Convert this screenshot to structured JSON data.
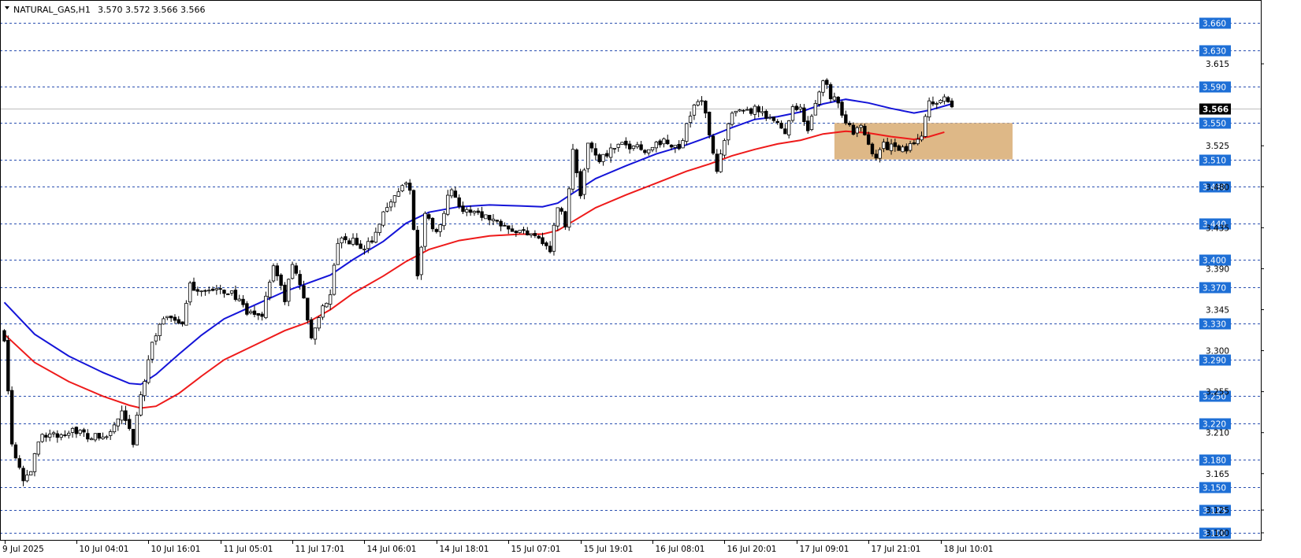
{
  "header": {
    "symbol_line": "NATURAL_GAS,H1",
    "ohlc": "3.570 3.572 3.566 3.566"
  },
  "colors": {
    "background": "#ffffff",
    "grid_level": "#2a4fb0",
    "level_badge": "#1e6fd6",
    "ema_fast": "#1414d8",
    "ema_slow": "#ee1a1a",
    "zone": "#deb887",
    "candle_up": "#ffffff",
    "candle_down": "#000000"
  },
  "chart_data": {
    "type": "candlestick",
    "symbol": "NATURAL_GAS",
    "timeframe": "H1",
    "last_price": "3.566",
    "ylim": [
      3.1,
      3.66
    ],
    "y_ticks": [
      "3.615",
      "3.525",
      "3.480",
      "3.435",
      "3.390",
      "3.345",
      "3.300",
      "3.255",
      "3.210",
      "3.165",
      "3.125",
      "3.100"
    ],
    "level_lines": [
      "3.660",
      "3.630",
      "3.590",
      "3.550",
      "3.510",
      "3.480",
      "3.440",
      "3.400",
      "3.370",
      "3.330",
      "3.290",
      "3.250",
      "3.220",
      "3.180",
      "3.150",
      "3.125",
      "3.100"
    ],
    "x_ticks": [
      {
        "label": "9 Jul 2025",
        "bar": 0
      },
      {
        "label": "10 Jul 04:01",
        "bar": 19
      },
      {
        "label": "10 Jul 16:01",
        "bar": 38
      },
      {
        "label": "11 Jul 05:01",
        "bar": 57
      },
      {
        "label": "11 Jul 17:01",
        "bar": 76
      },
      {
        "label": "14 Jul 06:01",
        "bar": 95
      },
      {
        "label": "14 Jul 18:01",
        "bar": 114
      },
      {
        "label": "15 Jul 07:01",
        "bar": 133
      },
      {
        "label": "15 Jul 19:01",
        "bar": 152
      },
      {
        "label": "16 Jul 08:01",
        "bar": 171
      },
      {
        "label": "16 Jul 20:01",
        "bar": 190
      },
      {
        "label": "17 Jul 09:01",
        "bar": 209
      },
      {
        "label": "17 Jul 21:01",
        "bar": 228
      },
      {
        "label": "18 Jul 10:01",
        "bar": 247
      }
    ],
    "anchors": [
      {
        "bar": 0,
        "price": 3.315
      },
      {
        "bar": 2,
        "price": 3.2
      },
      {
        "bar": 5,
        "price": 3.16
      },
      {
        "bar": 7,
        "price": 3.17
      },
      {
        "bar": 10,
        "price": 3.21
      },
      {
        "bar": 14,
        "price": 3.205
      },
      {
        "bar": 18,
        "price": 3.215
      },
      {
        "bar": 22,
        "price": 3.205
      },
      {
        "bar": 27,
        "price": 3.205
      },
      {
        "bar": 31,
        "price": 3.23
      },
      {
        "bar": 34,
        "price": 3.2
      },
      {
        "bar": 36,
        "price": 3.25
      },
      {
        "bar": 39,
        "price": 3.31
      },
      {
        "bar": 43,
        "price": 3.34
      },
      {
        "bar": 47,
        "price": 3.33
      },
      {
        "bar": 49,
        "price": 3.37
      },
      {
        "bar": 55,
        "price": 3.365
      },
      {
        "bar": 60,
        "price": 3.365
      },
      {
        "bar": 64,
        "price": 3.34
      },
      {
        "bar": 68,
        "price": 3.34
      },
      {
        "bar": 71,
        "price": 3.395
      },
      {
        "bar": 74,
        "price": 3.355
      },
      {
        "bar": 76,
        "price": 3.395
      },
      {
        "bar": 79,
        "price": 3.36
      },
      {
        "bar": 81,
        "price": 3.31
      },
      {
        "bar": 84,
        "price": 3.35
      },
      {
        "bar": 86,
        "price": 3.36
      },
      {
        "bar": 88,
        "price": 3.42
      },
      {
        "bar": 92,
        "price": 3.42
      },
      {
        "bar": 95,
        "price": 3.41
      },
      {
        "bar": 98,
        "price": 3.43
      },
      {
        "bar": 101,
        "price": 3.46
      },
      {
        "bar": 105,
        "price": 3.48
      },
      {
        "bar": 107,
        "price": 3.48
      },
      {
        "bar": 109,
        "price": 3.38
      },
      {
        "bar": 111,
        "price": 3.45
      },
      {
        "bar": 114,
        "price": 3.43
      },
      {
        "bar": 118,
        "price": 3.48
      },
      {
        "bar": 121,
        "price": 3.45
      },
      {
        "bar": 124,
        "price": 3.455
      },
      {
        "bar": 128,
        "price": 3.445
      },
      {
        "bar": 132,
        "price": 3.44
      },
      {
        "bar": 136,
        "price": 3.43
      },
      {
        "bar": 140,
        "price": 3.43
      },
      {
        "bar": 142,
        "price": 3.42
      },
      {
        "bar": 144,
        "price": 3.41
      },
      {
        "bar": 146,
        "price": 3.46
      },
      {
        "bar": 148,
        "price": 3.44
      },
      {
        "bar": 150,
        "price": 3.52
      },
      {
        "bar": 152,
        "price": 3.47
      },
      {
        "bar": 154,
        "price": 3.53
      },
      {
        "bar": 157,
        "price": 3.51
      },
      {
        "bar": 160,
        "price": 3.52
      },
      {
        "bar": 163,
        "price": 3.525
      },
      {
        "bar": 167,
        "price": 3.525
      },
      {
        "bar": 170,
        "price": 3.52
      },
      {
        "bar": 173,
        "price": 3.53
      },
      {
        "bar": 176,
        "price": 3.525
      },
      {
        "bar": 178,
        "price": 3.52
      },
      {
        "bar": 180,
        "price": 3.55
      },
      {
        "bar": 182,
        "price": 3.57
      },
      {
        "bar": 184,
        "price": 3.575
      },
      {
        "bar": 186,
        "price": 3.54
      },
      {
        "bar": 188,
        "price": 3.5
      },
      {
        "bar": 190,
        "price": 3.53
      },
      {
        "bar": 192,
        "price": 3.56
      },
      {
        "bar": 195,
        "price": 3.56
      },
      {
        "bar": 198,
        "price": 3.565
      },
      {
        "bar": 201,
        "price": 3.555
      },
      {
        "bar": 204,
        "price": 3.55
      },
      {
        "bar": 206,
        "price": 3.54
      },
      {
        "bar": 208,
        "price": 3.57
      },
      {
        "bar": 210,
        "price": 3.565
      },
      {
        "bar": 212,
        "price": 3.54
      },
      {
        "bar": 214,
        "price": 3.57
      },
      {
        "bar": 216,
        "price": 3.6
      },
      {
        "bar": 218,
        "price": 3.58
      },
      {
        "bar": 220,
        "price": 3.575
      },
      {
        "bar": 222,
        "price": 3.55
      },
      {
        "bar": 224,
        "price": 3.54
      },
      {
        "bar": 226,
        "price": 3.545
      },
      {
        "bar": 228,
        "price": 3.525
      },
      {
        "bar": 230,
        "price": 3.515
      },
      {
        "bar": 232,
        "price": 3.525
      },
      {
        "bar": 234,
        "price": 3.525
      },
      {
        "bar": 236,
        "price": 3.52
      },
      {
        "bar": 238,
        "price": 3.52
      },
      {
        "bar": 240,
        "price": 3.53
      },
      {
        "bar": 242,
        "price": 3.54
      },
      {
        "bar": 244,
        "price": 3.57
      },
      {
        "bar": 246,
        "price": 3.575
      },
      {
        "bar": 248,
        "price": 3.575
      },
      {
        "bar": 250,
        "price": 3.566
      }
    ],
    "zone": {
      "from_bar": 219,
      "to_bar": 266,
      "low": 3.51,
      "high": 3.55
    },
    "ma_fast": [
      {
        "bar": 0,
        "v": 3.353
      },
      {
        "bar": 8,
        "v": 3.318
      },
      {
        "bar": 17,
        "v": 3.294
      },
      {
        "bar": 26,
        "v": 3.276
      },
      {
        "bar": 33,
        "v": 3.264
      },
      {
        "bar": 36,
        "v": 3.263
      },
      {
        "bar": 40,
        "v": 3.274
      },
      {
        "bar": 46,
        "v": 3.296
      },
      {
        "bar": 52,
        "v": 3.317
      },
      {
        "bar": 58,
        "v": 3.335
      },
      {
        "bar": 66,
        "v": 3.35
      },
      {
        "bar": 74,
        "v": 3.365
      },
      {
        "bar": 80,
        "v": 3.374
      },
      {
        "bar": 86,
        "v": 3.383
      },
      {
        "bar": 92,
        "v": 3.4
      },
      {
        "bar": 100,
        "v": 3.42
      },
      {
        "bar": 106,
        "v": 3.44
      },
      {
        "bar": 112,
        "v": 3.452
      },
      {
        "bar": 120,
        "v": 3.458
      },
      {
        "bar": 128,
        "v": 3.46
      },
      {
        "bar": 136,
        "v": 3.459
      },
      {
        "bar": 142,
        "v": 3.458
      },
      {
        "bar": 146,
        "v": 3.462
      },
      {
        "bar": 150,
        "v": 3.473
      },
      {
        "bar": 156,
        "v": 3.489
      },
      {
        "bar": 164,
        "v": 3.503
      },
      {
        "bar": 172,
        "v": 3.516
      },
      {
        "bar": 180,
        "v": 3.526
      },
      {
        "bar": 186,
        "v": 3.535
      },
      {
        "bar": 192,
        "v": 3.545
      },
      {
        "bar": 198,
        "v": 3.554
      },
      {
        "bar": 204,
        "v": 3.557
      },
      {
        "bar": 210,
        "v": 3.562
      },
      {
        "bar": 216,
        "v": 3.571
      },
      {
        "bar": 222,
        "v": 3.576
      },
      {
        "bar": 228,
        "v": 3.572
      },
      {
        "bar": 234,
        "v": 3.566
      },
      {
        "bar": 240,
        "v": 3.561
      },
      {
        "bar": 244,
        "v": 3.564
      },
      {
        "bar": 250,
        "v": 3.571
      }
    ],
    "ma_slow": [
      {
        "bar": 0,
        "v": 3.318
      },
      {
        "bar": 8,
        "v": 3.287
      },
      {
        "bar": 17,
        "v": 3.266
      },
      {
        "bar": 26,
        "v": 3.25
      },
      {
        "bar": 33,
        "v": 3.24
      },
      {
        "bar": 36,
        "v": 3.237
      },
      {
        "bar": 40,
        "v": 3.239
      },
      {
        "bar": 46,
        "v": 3.253
      },
      {
        "bar": 52,
        "v": 3.272
      },
      {
        "bar": 58,
        "v": 3.29
      },
      {
        "bar": 66,
        "v": 3.306
      },
      {
        "bar": 74,
        "v": 3.322
      },
      {
        "bar": 80,
        "v": 3.331
      },
      {
        "bar": 86,
        "v": 3.345
      },
      {
        "bar": 92,
        "v": 3.363
      },
      {
        "bar": 100,
        "v": 3.382
      },
      {
        "bar": 106,
        "v": 3.398
      },
      {
        "bar": 112,
        "v": 3.411
      },
      {
        "bar": 120,
        "v": 3.421
      },
      {
        "bar": 128,
        "v": 3.426
      },
      {
        "bar": 136,
        "v": 3.428
      },
      {
        "bar": 142,
        "v": 3.428
      },
      {
        "bar": 146,
        "v": 3.432
      },
      {
        "bar": 150,
        "v": 3.442
      },
      {
        "bar": 156,
        "v": 3.457
      },
      {
        "bar": 164,
        "v": 3.471
      },
      {
        "bar": 172,
        "v": 3.484
      },
      {
        "bar": 180,
        "v": 3.497
      },
      {
        "bar": 186,
        "v": 3.505
      },
      {
        "bar": 192,
        "v": 3.514
      },
      {
        "bar": 198,
        "v": 3.521
      },
      {
        "bar": 204,
        "v": 3.527
      },
      {
        "bar": 210,
        "v": 3.531
      },
      {
        "bar": 216,
        "v": 3.538
      },
      {
        "bar": 222,
        "v": 3.541
      },
      {
        "bar": 228,
        "v": 3.539
      },
      {
        "bar": 234,
        "v": 3.535
      },
      {
        "bar": 240,
        "v": 3.532
      },
      {
        "bar": 244,
        "v": 3.535
      },
      {
        "bar": 248,
        "v": 3.54
      }
    ]
  }
}
